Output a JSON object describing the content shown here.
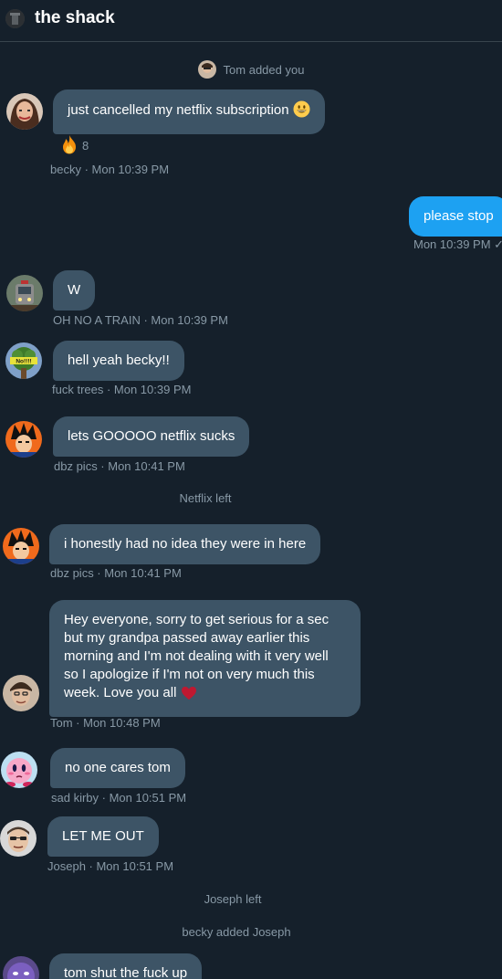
{
  "header": {
    "title": "the shack"
  },
  "events": {
    "tom_added": "Tom added you",
    "netflix_left": "Netflix left",
    "joseph_left": "Joseph left",
    "becky_added_joseph": "becky added Joseph"
  },
  "messages": [
    {
      "sender": "becky",
      "text": "just cancelled my netflix subscription",
      "emoji": "grinning-face",
      "reaction": {
        "emoji": "fire",
        "count": "8"
      },
      "meta": "becky · Mon 10:39 PM"
    },
    {
      "sender": "me",
      "text": "please stop",
      "meta": "Mon 10:39 PM ✓"
    },
    {
      "sender": "OH NO A TRAIN",
      "text": "W",
      "meta": "OH NO A TRAIN · Mon 10:39 PM"
    },
    {
      "sender": "fuck trees",
      "text": "hell yeah becky!!",
      "meta": "fuck trees · Mon 10:39 PM"
    },
    {
      "sender": "dbz pics",
      "text": "lets GOOOOO netflix sucks",
      "meta": "dbz pics · Mon 10:41 PM"
    },
    {
      "sender": "dbz pics",
      "text": "i honestly had no idea they were in here",
      "meta": "dbz pics · Mon 10:41 PM"
    },
    {
      "sender": "Tom",
      "text": "Hey everyone, sorry to get serious for a sec but my grandpa passed away earlier this morning and I'm not dealing with it very well so I apologize if I'm not on very much this week. Love you all",
      "emoji": "red-heart",
      "meta": "Tom · Mon 10:48 PM"
    },
    {
      "sender": "sad kirby",
      "text": "no one cares tom",
      "meta": "sad kirby · Mon 10:51 PM"
    },
    {
      "sender": "Joseph",
      "text": "LET ME OUT",
      "meta": "Joseph · Mon 10:51 PM"
    },
    {
      "sender": "unknown",
      "text": "tom shut the fuck up"
    }
  ],
  "avatar_labels": {
    "fuck_trees": "No!!!!"
  },
  "colors": {
    "background": "#15202b",
    "bubble": "#3d5466",
    "own_bubble": "#1da1f2",
    "meta_text": "#8899a6",
    "divider": "#38444d"
  }
}
